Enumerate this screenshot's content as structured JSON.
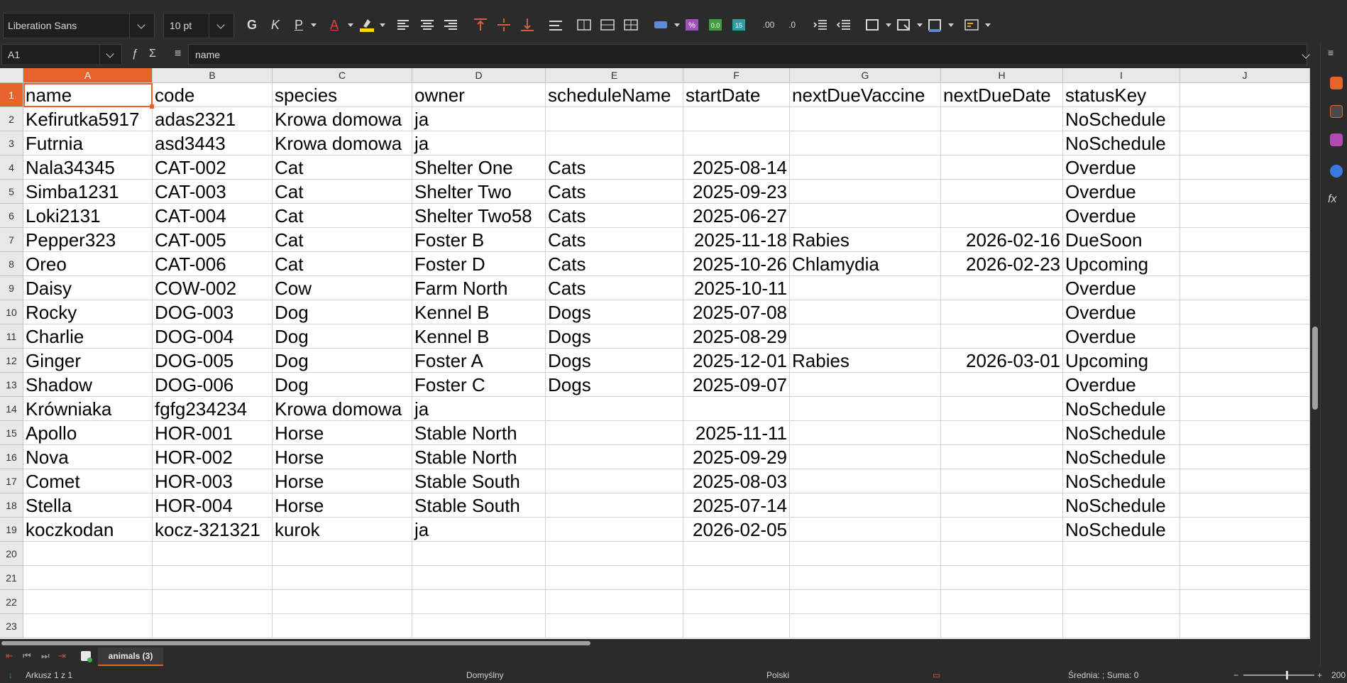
{
  "toolbar": {
    "font_name": "Liberation Sans",
    "font_size": "10 pt",
    "bold_label": "G",
    "italic_label": "K",
    "underline_label": "P",
    "font_color_label": "A"
  },
  "formula_bar": {
    "cell_ref": "A1",
    "content": "name"
  },
  "columns": [
    "A",
    "B",
    "C",
    "D",
    "E",
    "F",
    "G",
    "H",
    "I",
    "J"
  ],
  "rows_visible": [
    "1",
    "2",
    "3",
    "4",
    "5",
    "6",
    "7",
    "8",
    "9",
    "10",
    "11",
    "12",
    "13",
    "14",
    "15",
    "16",
    "17",
    "18",
    "19",
    "20",
    "21",
    "22",
    "23"
  ],
  "table": {
    "header": [
      "name",
      "code",
      "species",
      "owner",
      "scheduleName",
      "startDate",
      "nextDueVaccine",
      "nextDueDate",
      "statusKey"
    ],
    "rows": [
      [
        "Kefirutka5917",
        "adas2321",
        "Krowa domowa",
        "ja",
        "",
        "",
        "",
        "",
        "NoSchedule"
      ],
      [
        "Futrnia",
        "asd3443",
        "Krowa domowa",
        "ja",
        "",
        "",
        "",
        "",
        "NoSchedule"
      ],
      [
        "Nala34345",
        "CAT-002",
        "Cat",
        "Shelter One",
        "Cats",
        "2025-08-14",
        "",
        "",
        "Overdue"
      ],
      [
        "Simba1231",
        "CAT-003",
        "Cat",
        "Shelter Two",
        "Cats",
        "2025-09-23",
        "",
        "",
        "Overdue"
      ],
      [
        "Loki2131",
        "CAT-004",
        "Cat",
        "Shelter Two58",
        "Cats",
        "2025-06-27",
        "",
        "",
        "Overdue"
      ],
      [
        "Pepper323",
        "CAT-005",
        "Cat",
        "Foster B",
        "Cats",
        "2025-11-18",
        "Rabies",
        "2026-02-16",
        "DueSoon"
      ],
      [
        "Oreo",
        "CAT-006",
        "Cat",
        "Foster D",
        "Cats",
        "2025-10-26",
        "Chlamydia",
        "2026-02-23",
        "Upcoming"
      ],
      [
        "Daisy",
        "COW-002",
        "Cow",
        "Farm North",
        "Cats",
        "2025-10-11",
        "",
        "",
        "Overdue"
      ],
      [
        "Rocky",
        "DOG-003",
        "Dog",
        "Kennel B",
        "Dogs",
        "2025-07-08",
        "",
        "",
        "Overdue"
      ],
      [
        "Charlie",
        "DOG-004",
        "Dog",
        "Kennel B",
        "Dogs",
        "2025-08-29",
        "",
        "",
        "Overdue"
      ],
      [
        "Ginger",
        "DOG-005",
        "Dog",
        "Foster A",
        "Dogs",
        "2025-12-01",
        "Rabies",
        "2026-03-01",
        "Upcoming"
      ],
      [
        "Shadow",
        "DOG-006",
        "Dog",
        "Foster C",
        "Dogs",
        "2025-09-07",
        "",
        "",
        "Overdue"
      ],
      [
        "Krówniaka",
        "fgfg234234",
        "Krowa domowa",
        "ja",
        "",
        "",
        "",
        "",
        "NoSchedule"
      ],
      [
        "Apollo",
        "HOR-001",
        "Horse",
        "Stable North",
        "",
        "2025-11-11",
        "",
        "",
        "NoSchedule"
      ],
      [
        "Nova",
        "HOR-002",
        "Horse",
        "Stable North",
        "",
        "2025-09-29",
        "",
        "",
        "NoSchedule"
      ],
      [
        "Comet",
        "HOR-003",
        "Horse",
        "Stable South",
        "",
        "2025-08-03",
        "",
        "",
        "NoSchedule"
      ],
      [
        "Stella",
        "HOR-004",
        "Horse",
        "Stable South",
        "",
        "2025-07-14",
        "",
        "",
        "NoSchedule"
      ],
      [
        "koczkodan",
        "kocz-321321",
        "kurok",
        "ja",
        "",
        "2026-02-05",
        "",
        "",
        "NoSchedule"
      ]
    ]
  },
  "sheet_tab": "animals (3)",
  "status": {
    "sheet_position": "Arkusz 1 z 1",
    "page_style": "Domyślny",
    "language": "Polski",
    "summary": "Średnia: ; Suma: 0",
    "zoom": "200"
  },
  "colors": {
    "accent": "#e8622b",
    "chrome": "#2b2b2b",
    "grid": "#d4d4d4"
  }
}
